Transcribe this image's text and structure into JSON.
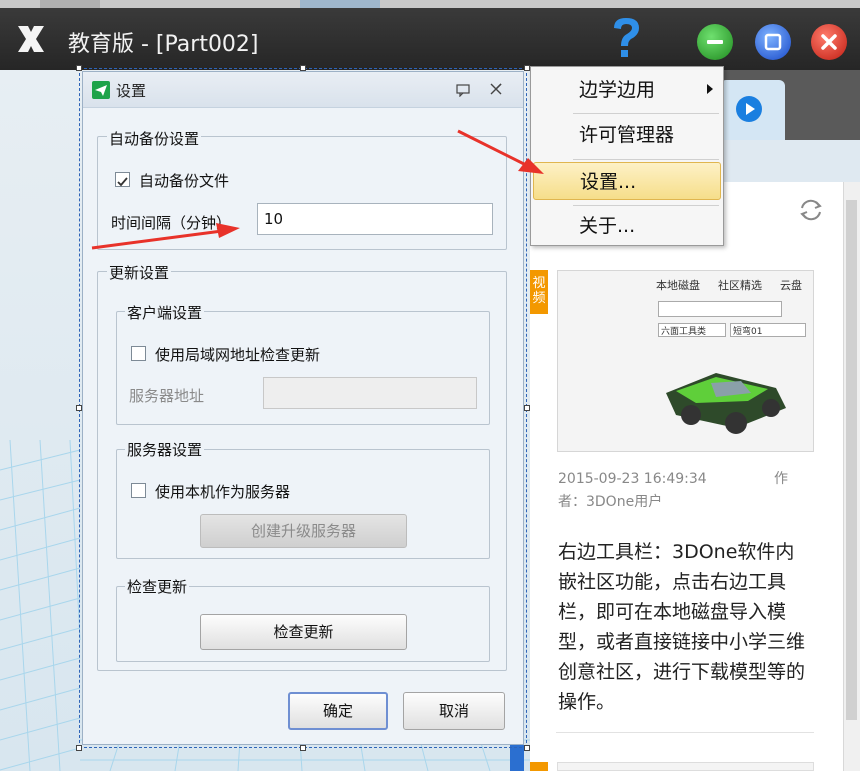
{
  "window": {
    "title": "教育版 - [Part002]",
    "controls": [
      "minimize",
      "maximize",
      "close"
    ]
  },
  "menu": {
    "items": [
      {
        "label": "边学边用",
        "has_submenu": true
      },
      {
        "label": "许可管理器"
      },
      {
        "label": "设置...",
        "highlighted": true
      },
      {
        "label": "关于..."
      }
    ]
  },
  "dialog": {
    "title": "设置",
    "auto_backup": {
      "group_title": "自动备份设置",
      "checkbox_label": "自动备份文件",
      "checked": true,
      "interval_label": "时间间隔（分钟）",
      "interval_value": "10"
    },
    "update": {
      "group_title": "更新设置",
      "client": {
        "group_title": "客户端设置",
        "checkbox_label": "使用局域网地址检查更新",
        "checked": false,
        "server_address_label": "服务器地址",
        "server_address_value": ""
      },
      "server": {
        "group_title": "服务器设置",
        "checkbox_label": "使用本机作为服务器",
        "checked": false,
        "create_button": "创建升级服务器"
      },
      "check": {
        "group_title": "检查更新",
        "button": "检查更新"
      }
    },
    "ok_button": "确定",
    "cancel_button": "取消"
  },
  "right_panel": {
    "badge": "视频",
    "thumbnail": {
      "tabs": [
        "本地磁盘",
        "社区精选",
        "云盘"
      ],
      "dropdown_1": "六面工具类",
      "dropdown_2": "短弯01"
    },
    "post": {
      "timestamp": "2015-09-23 16:49:34",
      "author_prefix": "作",
      "author": "者：3DOne用户",
      "body": "右边工具栏：3DOne软件内嵌社区功能，点击右边工具栏，即可在本地磁盘导入模型，或者直接链接中小学三维创意社区，进行下载模型等的操作。"
    }
  },
  "colors": {
    "titlebar": "#2e2e2e",
    "accent_arrow": "#e8322a",
    "menu_highlight": "#f6de8a",
    "badge": "#f39800"
  }
}
